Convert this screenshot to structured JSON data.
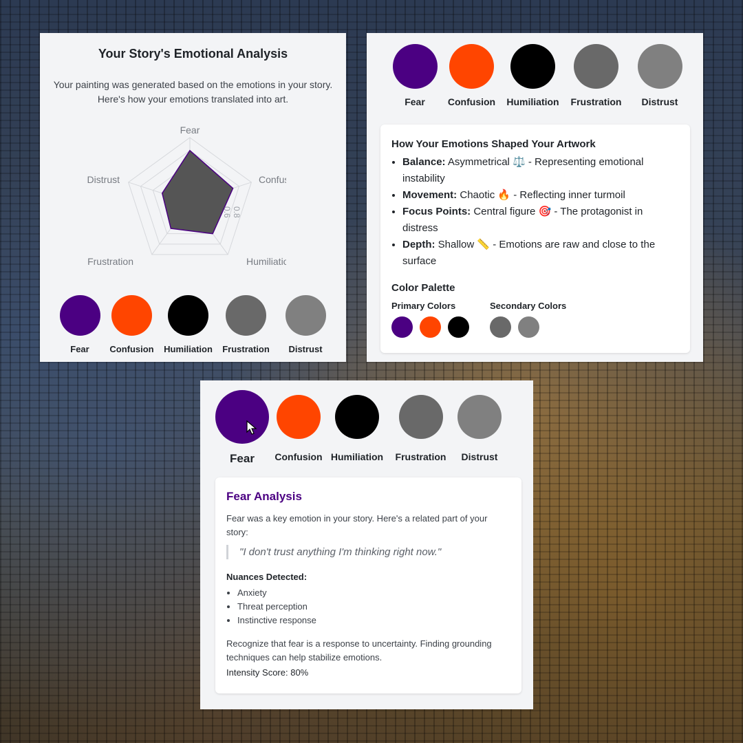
{
  "colors": {
    "fear": "#4b0082",
    "confusion": "#ff4500",
    "humiliation": "#000000",
    "frustration": "#696969",
    "distrust": "#808080"
  },
  "emotions": [
    "Fear",
    "Confusion",
    "Humiliation",
    "Frustration",
    "Distrust"
  ],
  "analysis_panel": {
    "title": "Your Story's Emotional Analysis",
    "description": "Your painting was generated based on the emotions in your story. Here's how your emotions translated into art.",
    "radar": {
      "axis_labels": [
        "Fear",
        "Confusi",
        "Humiliation",
        "Frustration",
        "Distrust"
      ],
      "tick_labels": [
        "0.6",
        "0.8"
      ],
      "values": [
        0.8,
        0.7,
        0.6,
        0.5,
        0.45
      ],
      "max": 1.0,
      "fill_color": "#555555",
      "stroke_color": "#4b0082"
    }
  },
  "artwork_panel": {
    "shaped_title": "How Your Emotions Shaped Your Artwork",
    "items": [
      {
        "label": "Balance:",
        "text": "Asymmetrical ⚖️ - Representing emotional instability"
      },
      {
        "label": "Movement:",
        "text": "Chaotic 🔥 - Reflecting inner turmoil"
      },
      {
        "label": "Focus Points:",
        "text": "Central figure 🎯 - The protagonist in distress"
      },
      {
        "label": "Depth:",
        "text": "Shallow 📏 - Emotions are raw and close to the surface"
      }
    ],
    "palette_title": "Color Palette",
    "primary_label": "Primary Colors",
    "secondary_label": "Secondary Colors",
    "primary_colors": [
      "#4b0082",
      "#ff4500",
      "#000000"
    ],
    "secondary_colors": [
      "#696969",
      "#808080"
    ]
  },
  "fear_panel": {
    "selected": "Fear",
    "title": "Fear Analysis",
    "description": "Fear was a key emotion in your story. Here's a related part of your story:",
    "quote": "\"I don't trust anything I'm thinking right now.\"",
    "nuances_title": "Nuances Detected:",
    "nuances": [
      "Anxiety",
      "Threat perception",
      "Instinctive response"
    ],
    "advice": "Recognize that fear is a response to uncertainty. Finding grounding techniques can help stabilize emotions.",
    "intensity_text": "Intensity Score: 80%",
    "intensity_score": 0.8
  }
}
